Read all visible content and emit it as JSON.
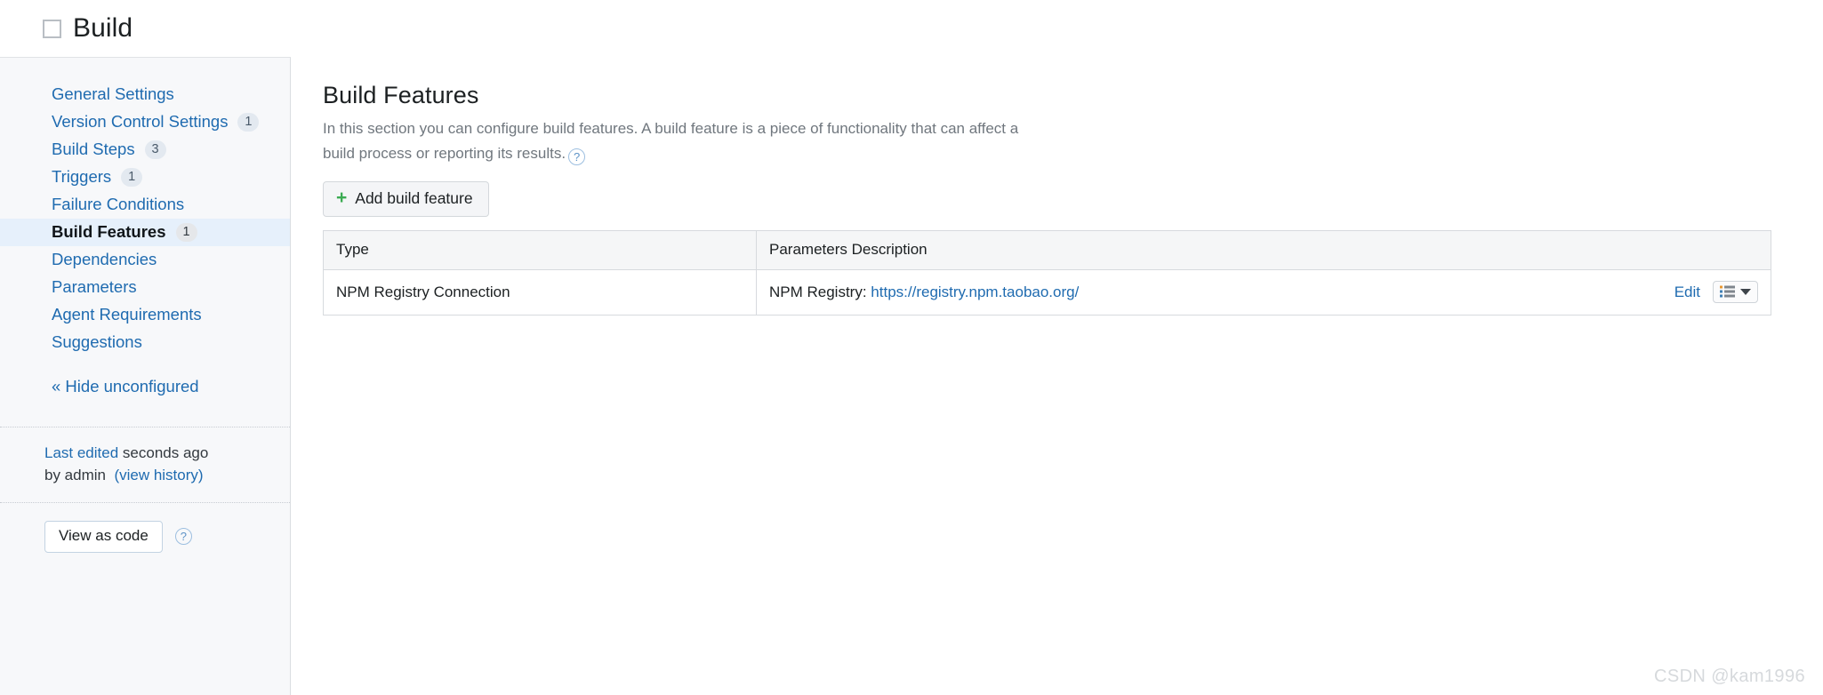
{
  "header": {
    "project_icon": "square-outline-icon",
    "title": "Build"
  },
  "sidebar": {
    "items": [
      {
        "label": "General Settings",
        "badge": "",
        "active": false
      },
      {
        "label": "Version Control Settings",
        "badge": "1",
        "active": false
      },
      {
        "label": "Build Steps",
        "badge": "3",
        "active": false
      },
      {
        "label": "Triggers",
        "badge": "1",
        "active": false
      },
      {
        "label": "Failure Conditions",
        "badge": "",
        "active": false
      },
      {
        "label": "Build Features",
        "badge": "1",
        "active": true
      },
      {
        "label": "Dependencies",
        "badge": "",
        "active": false
      },
      {
        "label": "Parameters",
        "badge": "",
        "active": false
      },
      {
        "label": "Agent Requirements",
        "badge": "",
        "active": false
      },
      {
        "label": "Suggestions",
        "badge": "",
        "active": false
      }
    ],
    "hide_unconfigured": "« Hide unconfigured",
    "meta": {
      "last_edited_link": "Last edited",
      "last_edited_when": " seconds ago",
      "by_line": "by admin",
      "view_history": "(view history)"
    },
    "view_as_code_button": "View as code",
    "view_as_code_help": "?"
  },
  "main": {
    "title": "Build Features",
    "description": "In this section you can configure build features. A build feature is a piece of functionality that can affect a build process or reporting its results.",
    "description_help": "?",
    "add_button": {
      "icon": "plus-icon",
      "label": "Add build feature"
    },
    "table": {
      "columns": [
        "Type",
        "Parameters Description"
      ],
      "rows": [
        {
          "type": "NPM Registry Connection",
          "param_label": "NPM Registry: ",
          "param_link": "https://registry.npm.taobao.org/",
          "edit_label": "Edit",
          "menu_icon": "list-menu-icon",
          "menu_caret": "chevron-down-icon"
        }
      ]
    }
  },
  "watermark": "CSDN @kam1996",
  "colors": {
    "link": "#1f6bb0",
    "active_row_bg": "#e6f0fb",
    "sidebar_bg": "#f7f8fa",
    "plus_green": "#3bab52",
    "table_header_bg": "#f5f6f7",
    "border": "#d7dade"
  }
}
